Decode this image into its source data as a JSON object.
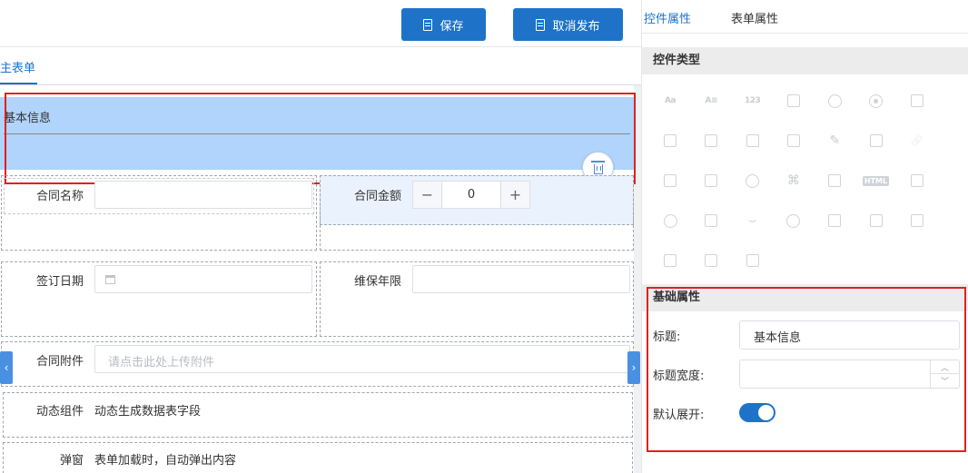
{
  "toolbar": {
    "save_label": "保存",
    "unpublish_label": "取消发布"
  },
  "form_tabs": {
    "main": "主表单"
  },
  "section": {
    "title": "基本信息"
  },
  "fields": {
    "contract_name": "合同名称",
    "contract_amount": "合同金额",
    "amount_value": "0",
    "sign_date": "签订日期",
    "maintenance_years": "维保年限",
    "attachment": "合同附件",
    "attachment_placeholder": "请点击此处上传附件",
    "dynamic_label": "动态组件",
    "dynamic_text": "动态生成数据表字段",
    "popup_label": "弹窗",
    "popup_text": "表单加载时，自动弹出内容"
  },
  "right_panel": {
    "tabs": [
      "控件属性",
      "表单属性"
    ],
    "control_type_header": "控件类型",
    "basic_props_header": "基础属性",
    "props": {
      "title_label": "标题:",
      "title_value": "基本信息",
      "title_width_label": "标题宽度:",
      "default_expand_label": "默认展开:"
    },
    "icons": [
      {
        "name": "text-aa-icon",
        "text": "Aa"
      },
      {
        "name": "textarea-icon",
        "text": "A≡"
      },
      {
        "name": "number-icon",
        "text": "123"
      },
      {
        "name": "calendar-icon"
      },
      {
        "name": "clock-icon"
      },
      {
        "name": "radio-icon"
      },
      {
        "name": "checkbox-icon"
      },
      {
        "name": "dropdown-icon"
      },
      {
        "name": "copy-icon"
      },
      {
        "name": "multi-select-icon"
      },
      {
        "name": "cascade-icon"
      },
      {
        "name": "edit-icon"
      },
      {
        "name": "document-icon"
      },
      {
        "name": "link-icon"
      },
      {
        "name": "attachment-doc-icon"
      },
      {
        "name": "image-icon"
      },
      {
        "name": "user-icon"
      },
      {
        "name": "org-icon"
      },
      {
        "name": "card-icon"
      },
      {
        "name": "html-icon",
        "text": "HTML"
      },
      {
        "name": "barcode-icon"
      },
      {
        "name": "toggle-icon"
      },
      {
        "name": "list-icon"
      },
      {
        "name": "divider-icon"
      },
      {
        "name": "stamp-icon"
      },
      {
        "name": "check-doc-icon"
      },
      {
        "name": "sub-form-icon"
      },
      {
        "name": "frame-icon"
      },
      {
        "name": "ocr-icon"
      },
      {
        "name": "page-icon"
      },
      {
        "name": "qrcode-icon"
      }
    ],
    "default_expand": true
  },
  "colors": {
    "primary": "#1e73c9",
    "section_bg": "#b0d4fb",
    "highlight": "#e02020"
  }
}
